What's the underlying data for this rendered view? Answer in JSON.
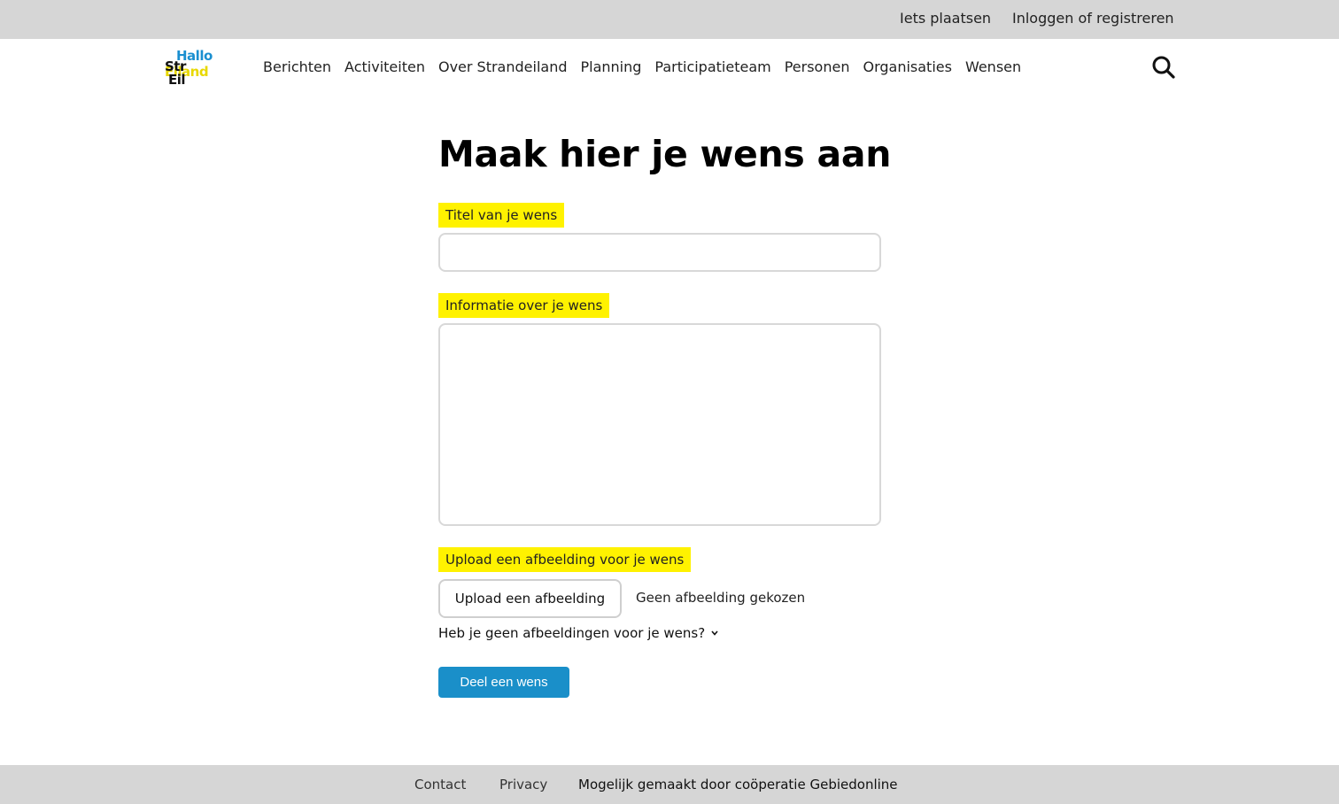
{
  "topbar": {
    "post_link": "Iets plaatsen",
    "login_link": "Inloggen of registreren"
  },
  "logo": {
    "line1": "Hallo",
    "line2": "Str",
    "line3": "Eiland",
    "line4": "Eil",
    "colors": {
      "blue": "#1a8fd0",
      "yellow": "#e8d800",
      "black": "#111111"
    }
  },
  "nav": {
    "items": [
      "Berichten",
      "Activiteiten",
      "Over Strandeiland",
      "Planning",
      "Participatieteam",
      "Personen",
      "Organisaties",
      "Wensen"
    ],
    "search_icon": "search-icon"
  },
  "form": {
    "heading": "Maak hier je wens aan",
    "title_label": "Titel van je wens",
    "title_value": "",
    "info_label": "Informatie over je wens",
    "info_value": "",
    "upload_label": "Upload een afbeelding voor je wens",
    "upload_button": "Upload een afbeelding",
    "no_file_text": "Geen afbeelding gekozen",
    "no_images_toggle": "Heb je geen afbeeldingen voor je wens?",
    "submit_button": "Deel een wens",
    "label_highlight": "#fff200",
    "submit_color": "#1a8fc9"
  },
  "footer": {
    "contact": "Contact",
    "privacy": "Privacy",
    "credit": "Mogelijk gemaakt door coöperatie Gebiedonline"
  }
}
